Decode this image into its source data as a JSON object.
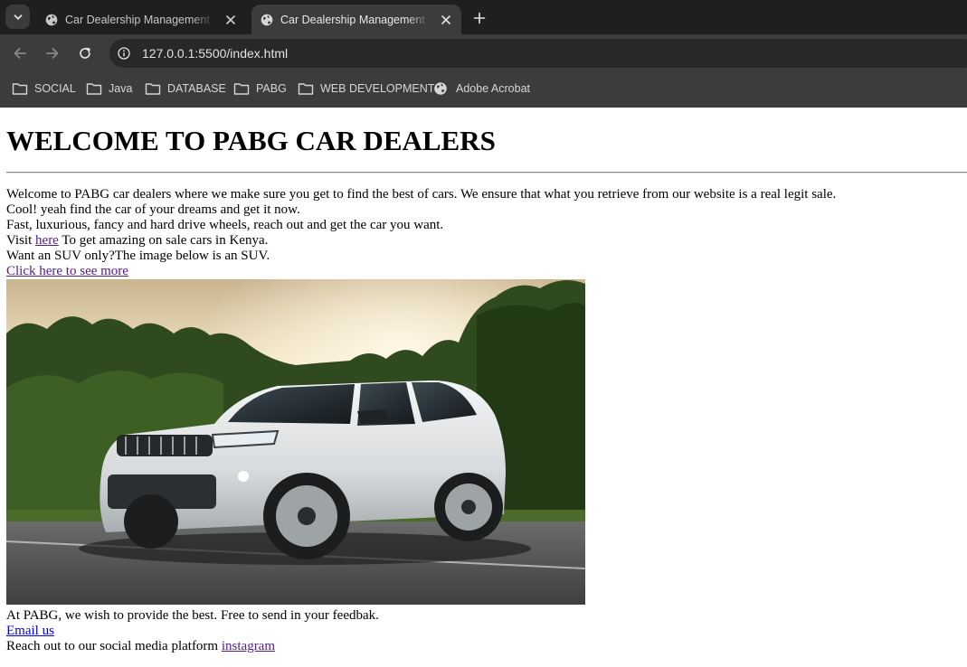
{
  "browser": {
    "tabs": [
      {
        "title": "Car Dealership Management System",
        "active": false
      },
      {
        "title": "Car Dealership Management System",
        "active": true
      }
    ],
    "url": "127.0.0.1:5500/index.html",
    "bookmarks": [
      {
        "label": "SOCIAL",
        "icon": "folder-icon"
      },
      {
        "label": "Java",
        "icon": "folder-icon"
      },
      {
        "label": "DATABASE",
        "icon": "folder-icon"
      },
      {
        "label": "PABG",
        "icon": "folder-icon"
      },
      {
        "label": "WEB DEVELOPMENT",
        "icon": "folder-icon"
      },
      {
        "label": "Adobe Acrobat",
        "icon": "globe-icon"
      }
    ],
    "colors": {
      "tabstrip": "#1f1f1f",
      "toolbar": "#3c3c3c",
      "omnibox": "#282828"
    }
  },
  "page": {
    "heading": "WELCOME TO PABG CAR DEALERS",
    "line1": "Welcome to PABG car dealers where we make sure you get to find the best of cars. We ensure that what you retrieve from our website is a real legit sale.",
    "line2": "Cool! yeah find the car of your dreams and get it now.",
    "line3": "Fast, luxurious, fancy and hard drive wheels, reach out and get the car you want.",
    "visit_prefix": "Visit ",
    "visit_link": "here",
    "visit_suffix": " To get amazing on sale cars in Kenya.",
    "line5": "Want an SUV only?The image below is an SUV.",
    "more_link": "Click here to see more",
    "image_subject": "white SUV parked on road with trees and sunset sky",
    "footer_line": "At PABG, we wish to provide the best. Free to send in your feedbak.",
    "email_link": "Email us",
    "social_prefix": "Reach out to our social media platform ",
    "social_link": "instagram",
    "colors": {
      "visited_link": "#551a8b",
      "link": "#0000ee"
    }
  }
}
